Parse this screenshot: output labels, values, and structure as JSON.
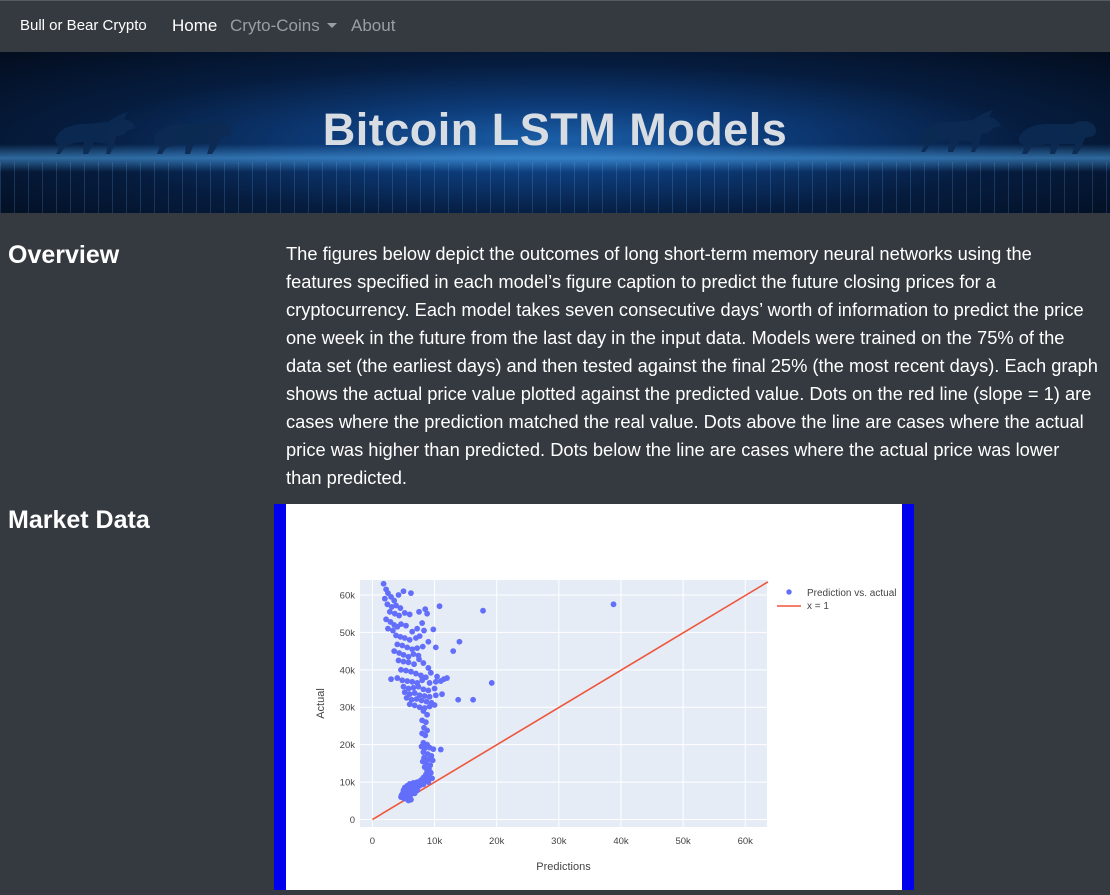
{
  "navbar": {
    "brand": "Bull or Bear Crypto",
    "links": [
      {
        "label": "Home",
        "active": true
      },
      {
        "label": "Cryto-Coins",
        "dropdown": true
      },
      {
        "label": "About"
      }
    ]
  },
  "banner": {
    "title": "Bitcoin LSTM Models"
  },
  "overview": {
    "heading": "Overview",
    "text": "The figures below depict the outcomes of long short-term memory neural networks using the features specified in each model’s figure caption to predict the future closing prices for a cryptocurrency. Each model takes seven consecutive days’ worth of information to predict the price one week in the future from the last day in the input data. Models were trained on the 75% of the data set (the earliest days) and then tested against the final 25% (the most recent days). Each graph shows the actual price value plotted against the predicted value. Dots on the red line (slope = 1) are cases where the prediction matched the real value. Dots above the line are cases where the actual price was higher than predicted. Dots below the line are cases where the actual price was lower than predicted."
  },
  "market": {
    "heading": "Market Data"
  },
  "colors": {
    "navbar_bg": "#343a40",
    "page_bg": "#343a40",
    "plot_bg": "#e5ecf6",
    "marker": "#636efa",
    "line": "#ef553b",
    "frame": "#0000ee"
  },
  "chart_data": {
    "type": "scatter",
    "title": "",
    "xlabel": "Predictions",
    "ylabel": "Actual",
    "xlim": [
      -2000,
      63500
    ],
    "ylim": [
      -2000,
      64000
    ],
    "x_ticks": [
      0,
      10000,
      20000,
      30000,
      40000,
      50000,
      60000
    ],
    "x_tick_labels": [
      "0",
      "10k",
      "20k",
      "30k",
      "40k",
      "50k",
      "60k"
    ],
    "y_ticks": [
      0,
      10000,
      20000,
      30000,
      40000,
      50000,
      60000
    ],
    "y_tick_labels": [
      "0",
      "10k",
      "20k",
      "30k",
      "40k",
      "50k",
      "60k"
    ],
    "grid": true,
    "legend_position": "top-right",
    "series": [
      {
        "name": "Prediction vs. actual",
        "mode": "markers",
        "color": "#636efa",
        "points": [
          [
            1800,
            63000
          ],
          [
            2200,
            61500
          ],
          [
            2500,
            60500
          ],
          [
            3000,
            59500
          ],
          [
            2000,
            59000
          ],
          [
            3500,
            58500
          ],
          [
            4200,
            60000
          ],
          [
            5000,
            61000
          ],
          [
            6200,
            60500
          ],
          [
            2400,
            57500
          ],
          [
            3100,
            56800
          ],
          [
            3800,
            57200
          ],
          [
            4500,
            56500
          ],
          [
            2800,
            55500
          ],
          [
            3600,
            55000
          ],
          [
            4300,
            54500
          ],
          [
            5200,
            55200
          ],
          [
            6000,
            54800
          ],
          [
            7500,
            55500
          ],
          [
            8500,
            56200
          ],
          [
            8800,
            55000
          ],
          [
            10800,
            57000
          ],
          [
            17800,
            55800
          ],
          [
            38800,
            57500
          ],
          [
            2200,
            53500
          ],
          [
            2900,
            52800
          ],
          [
            3500,
            52000
          ],
          [
            4000,
            51500
          ],
          [
            4600,
            52200
          ],
          [
            5400,
            51800
          ],
          [
            2500,
            51000
          ],
          [
            3300,
            50500
          ],
          [
            6400,
            50200
          ],
          [
            7200,
            51000
          ],
          [
            8000,
            52500
          ],
          [
            9800,
            50800
          ],
          [
            8300,
            50500
          ],
          [
            3800,
            49200
          ],
          [
            4500,
            48800
          ],
          [
            5200,
            48500
          ],
          [
            6000,
            48000
          ],
          [
            7000,
            48500
          ],
          [
            7600,
            49000
          ],
          [
            9000,
            47500
          ],
          [
            10200,
            46000
          ],
          [
            13000,
            45000
          ],
          [
            14000,
            47500
          ],
          [
            4000,
            46800
          ],
          [
            4800,
            46500
          ],
          [
            5600,
            46000
          ],
          [
            6400,
            45500
          ],
          [
            7200,
            45800
          ],
          [
            8100,
            46200
          ],
          [
            3500,
            45000
          ],
          [
            4300,
            44500
          ],
          [
            5000,
            44000
          ],
          [
            5800,
            43500
          ],
          [
            6600,
            44200
          ],
          [
            7400,
            43800
          ],
          [
            4200,
            42500
          ],
          [
            5000,
            42200
          ],
          [
            5800,
            42000
          ],
          [
            6700,
            41500
          ],
          [
            7500,
            42800
          ],
          [
            8200,
            41800
          ],
          [
            9000,
            40500
          ],
          [
            4600,
            40000
          ],
          [
            5400,
            39800
          ],
          [
            6200,
            39500
          ],
          [
            7000,
            39000
          ],
          [
            7800,
            38500
          ],
          [
            8600,
            38000
          ],
          [
            9400,
            39200
          ],
          [
            10400,
            38200
          ],
          [
            11500,
            37500
          ],
          [
            12000,
            37800
          ],
          [
            3000,
            37500
          ],
          [
            4000,
            37800
          ],
          [
            4800,
            37200
          ],
          [
            5600,
            37000
          ],
          [
            6400,
            36800
          ],
          [
            7200,
            36500
          ],
          [
            8000,
            37200
          ],
          [
            9200,
            36500
          ],
          [
            10200,
            36800
          ],
          [
            11000,
            37000
          ],
          [
            19200,
            36500
          ],
          [
            5000,
            35500
          ],
          [
            5800,
            35000
          ],
          [
            6600,
            35200
          ],
          [
            7400,
            35500
          ],
          [
            8200,
            34800
          ],
          [
            9000,
            34500
          ],
          [
            10000,
            35000
          ],
          [
            5200,
            34000
          ],
          [
            6000,
            33500
          ],
          [
            6800,
            33800
          ],
          [
            7600,
            33200
          ],
          [
            8400,
            33000
          ],
          [
            9200,
            32800
          ],
          [
            10200,
            33200
          ],
          [
            11200,
            33500
          ],
          [
            5500,
            32500
          ],
          [
            6300,
            32000
          ],
          [
            7100,
            32200
          ],
          [
            7900,
            31800
          ],
          [
            8700,
            31500
          ],
          [
            9500,
            31200
          ],
          [
            13800,
            32000
          ],
          [
            16200,
            32000
          ],
          [
            6000,
            30800
          ],
          [
            6800,
            30500
          ],
          [
            7600,
            30000
          ],
          [
            8400,
            29800
          ],
          [
            9200,
            30200
          ],
          [
            10000,
            30600
          ],
          [
            8200,
            29000
          ],
          [
            8800,
            28000
          ],
          [
            8000,
            26500
          ],
          [
            8600,
            26000
          ],
          [
            8300,
            24500
          ],
          [
            8800,
            23800
          ],
          [
            8000,
            23000
          ],
          [
            8500,
            22500
          ],
          [
            8200,
            20500
          ],
          [
            8800,
            20000
          ],
          [
            7900,
            19500
          ],
          [
            8400,
            19000
          ],
          [
            9200,
            19200
          ],
          [
            9800,
            18800
          ],
          [
            11000,
            18700
          ],
          [
            8200,
            18000
          ],
          [
            8900,
            17500
          ],
          [
            9500,
            17000
          ],
          [
            8300,
            16500
          ],
          [
            9000,
            16000
          ],
          [
            9700,
            15800
          ],
          [
            8100,
            15500
          ],
          [
            8600,
            15000
          ],
          [
            9300,
            14500
          ],
          [
            8400,
            14000
          ],
          [
            9100,
            13500
          ],
          [
            8800,
            13000
          ],
          [
            9400,
            12500
          ],
          [
            8600,
            12000
          ],
          [
            9200,
            11800
          ],
          [
            8200,
            11200
          ],
          [
            8900,
            10800
          ],
          [
            9600,
            11000
          ],
          [
            7800,
            10500
          ],
          [
            8400,
            10200
          ],
          [
            9000,
            10000
          ],
          [
            7200,
            10000
          ],
          [
            6600,
            9800
          ],
          [
            7400,
            9600
          ],
          [
            6000,
            9500
          ],
          [
            6800,
            9200
          ],
          [
            7600,
            9000
          ],
          [
            8200,
            9400
          ],
          [
            5600,
            9000
          ],
          [
            6300,
            8800
          ],
          [
            7000,
            8500
          ],
          [
            5200,
            8500
          ],
          [
            5800,
            8200
          ],
          [
            6500,
            8000
          ],
          [
            7200,
            7800
          ],
          [
            5000,
            7800
          ],
          [
            5600,
            7500
          ],
          [
            6200,
            7200
          ],
          [
            6800,
            7000
          ],
          [
            4900,
            7000
          ],
          [
            5500,
            6800
          ],
          [
            6100,
            6500
          ],
          [
            4700,
            6500
          ],
          [
            5300,
            6200
          ],
          [
            5900,
            6000
          ],
          [
            5000,
            5800
          ],
          [
            5600,
            5500
          ],
          [
            6200,
            5300
          ],
          [
            4600,
            6000
          ],
          [
            5200,
            5600
          ],
          [
            5800,
            5100
          ]
        ]
      },
      {
        "name": "x = 1",
        "mode": "line",
        "color": "#ef553b",
        "points": [
          [
            0,
            0
          ],
          [
            63500,
            63500
          ]
        ]
      }
    ]
  }
}
